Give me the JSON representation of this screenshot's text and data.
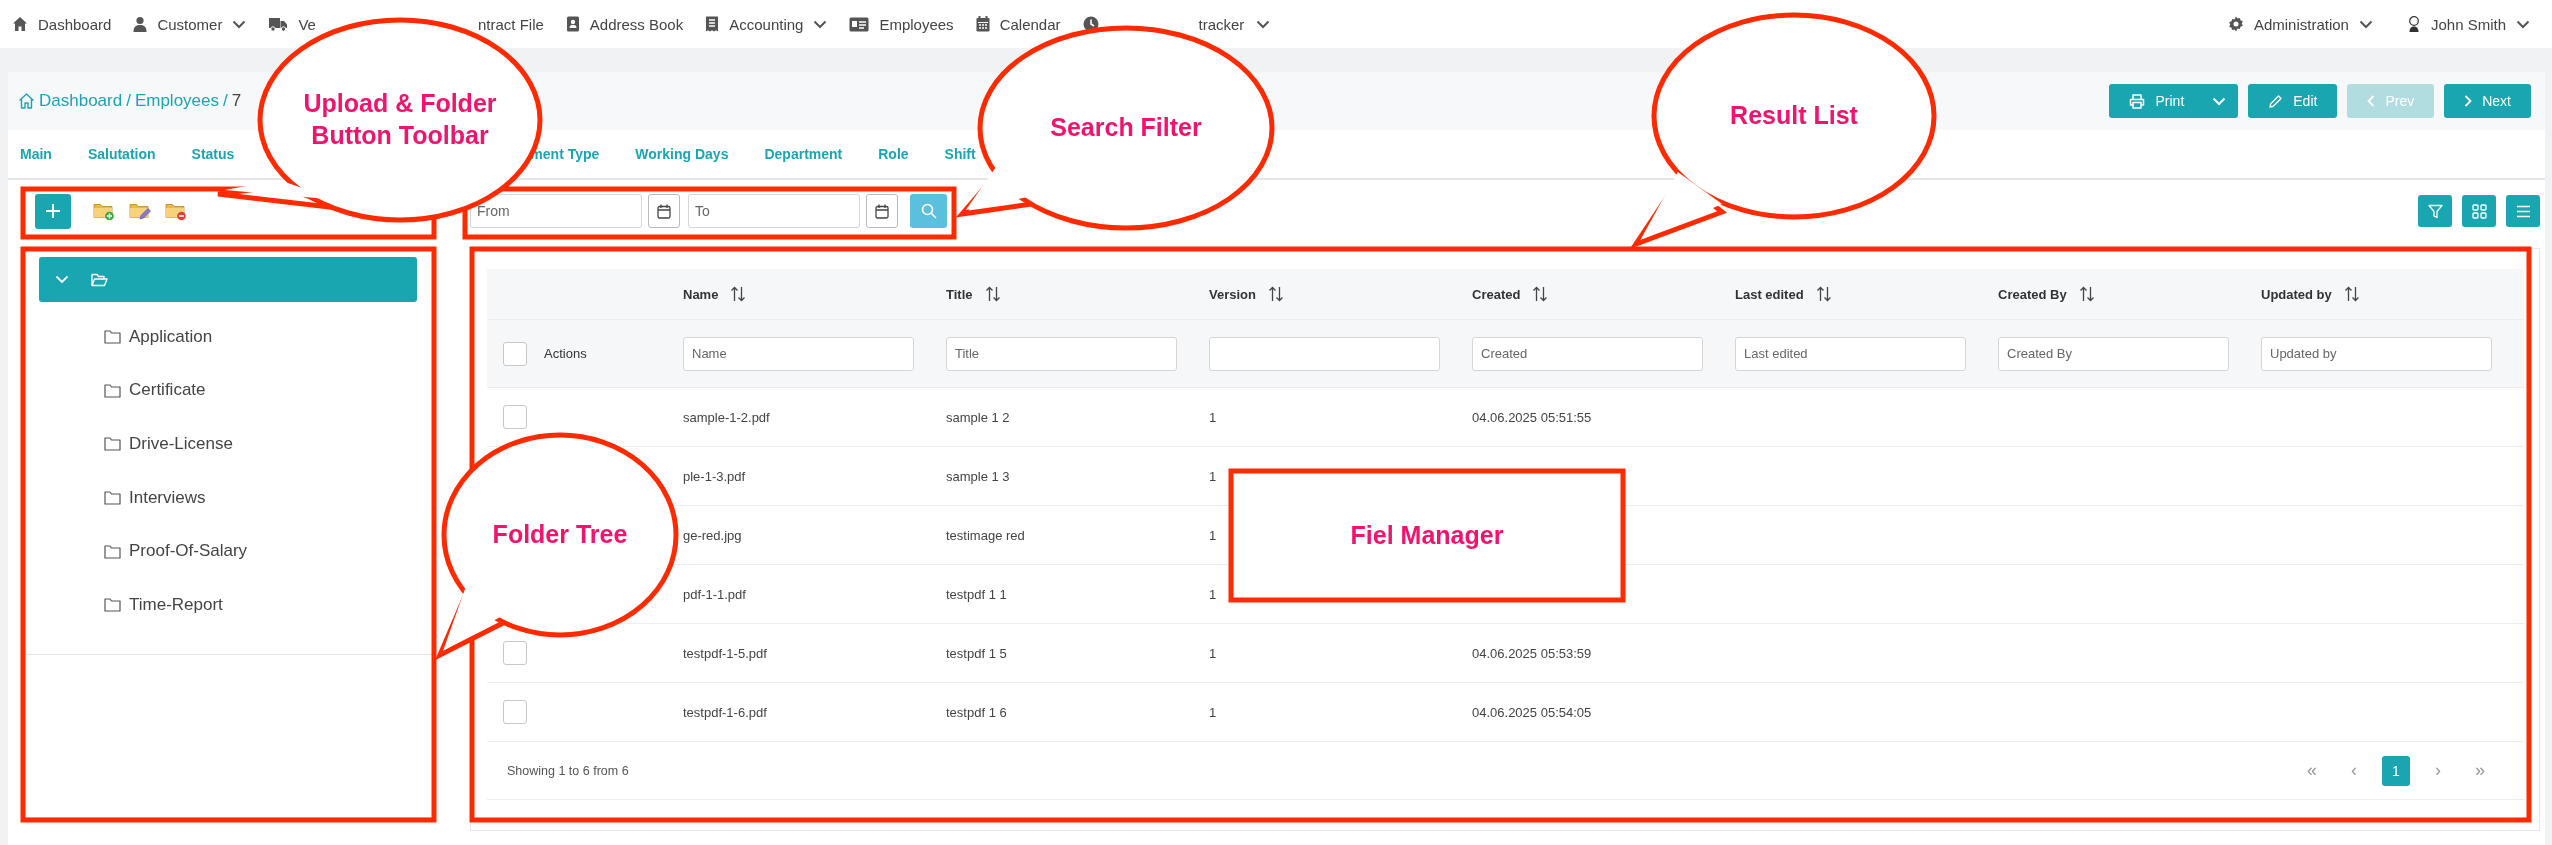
{
  "top_nav": {
    "items": [
      {
        "label": "Dashboard",
        "has_menu": false
      },
      {
        "label": "Customer",
        "has_menu": true
      },
      {
        "label": "Ve",
        "has_menu": false
      },
      {
        "label": "ntract File",
        "has_menu": false
      },
      {
        "label": "Address Book",
        "has_menu": false
      },
      {
        "label": "Accounting",
        "has_menu": true
      },
      {
        "label": "Employees",
        "has_menu": false
      },
      {
        "label": "Calendar",
        "has_menu": false
      },
      {
        "label": "tracker",
        "has_menu": true
      }
    ],
    "right_items": [
      {
        "label": "Administration",
        "has_menu": true
      },
      {
        "label": "John Smith",
        "has_menu": true
      }
    ]
  },
  "breadcrumb": {
    "links": [
      "Dashboard",
      "Employees"
    ],
    "separator": "/",
    "current": "7"
  },
  "actions": [
    {
      "label": "Print",
      "disabled": false
    },
    {
      "label": "Edit",
      "disabled": false
    },
    {
      "label": "Prev",
      "disabled": true
    },
    {
      "label": "Next",
      "disabled": false
    }
  ],
  "tabs": [
    "Main",
    "Salutation",
    "Status",
    "ment Type",
    "Working Days",
    "Department",
    "Role",
    "Shift"
  ],
  "tree": {
    "root": {
      "expanded": true,
      "selected": true,
      "children": [
        {
          "label": "Application"
        },
        {
          "label": "Certificate"
        },
        {
          "label": "Drive-License"
        },
        {
          "label": "Interviews"
        },
        {
          "label": "Proof-Of-Salary"
        },
        {
          "label": "Time-Report"
        }
      ]
    }
  },
  "date_filter": {
    "from": {
      "placeholder": "From"
    },
    "to": {
      "placeholder": "To"
    }
  },
  "table": {
    "columns": [
      "Name",
      "Title",
      "Version",
      "Created",
      "Last edited",
      "Created By",
      "Updated by"
    ],
    "actions_label": "Actions",
    "select_all_checked": false,
    "filters": [
      {
        "kind": "text",
        "placeholder": "Name"
      },
      {
        "kind": "text",
        "placeholder": "Title"
      },
      {
        "kind": "blank"
      },
      {
        "kind": "text",
        "placeholder": "Created"
      },
      {
        "kind": "text",
        "placeholder": "Last edited"
      },
      {
        "kind": "text",
        "placeholder": "Created By"
      },
      {
        "kind": "text",
        "placeholder": "Updated by"
      }
    ],
    "rows": [
      {
        "checked": false,
        "cells": [
          "sample-1-2.pdf",
          "sample 1 2",
          "1",
          "04.06.2025 05:51:55"
        ]
      },
      {
        "cells": [
          "ple-1-3.pdf",
          "sample 1 3",
          "1"
        ]
      },
      {
        "cells": [
          "ge-red.jpg",
          "testimage red",
          "1"
        ]
      },
      {
        "cells": [
          "pdf-1-1.pdf",
          "testpdf 1 1",
          "1"
        ]
      },
      {
        "checked": false,
        "cells": [
          "testpdf-1-5.pdf",
          "testpdf 1 5",
          "1",
          "04.06.2025 05:53:59"
        ]
      },
      {
        "checked": false,
        "cells": [
          "testpdf-1-6.pdf",
          "testpdf 1 6",
          "1",
          "04.06.2025 05:54:05"
        ]
      }
    ],
    "summary": "Showing 1 to 6 from 6",
    "pager": {
      "first": "«",
      "prev": "‹",
      "pages": [
        {
          "label": "1",
          "selected": true
        }
      ],
      "next": "›",
      "last": "»"
    }
  },
  "annotations": [
    {
      "kind": "bubble",
      "lines": [
        "Upload & Folder",
        "Button Toolbar"
      ]
    },
    {
      "kind": "bubble",
      "lines": [
        "Search Filter"
      ]
    },
    {
      "kind": "bubble",
      "lines": [
        "Result List"
      ]
    },
    {
      "kind": "bubble",
      "lines": [
        "Folder Tree"
      ]
    },
    {
      "kind": "box",
      "lines": [
        "Fiel Manager"
      ]
    }
  ]
}
